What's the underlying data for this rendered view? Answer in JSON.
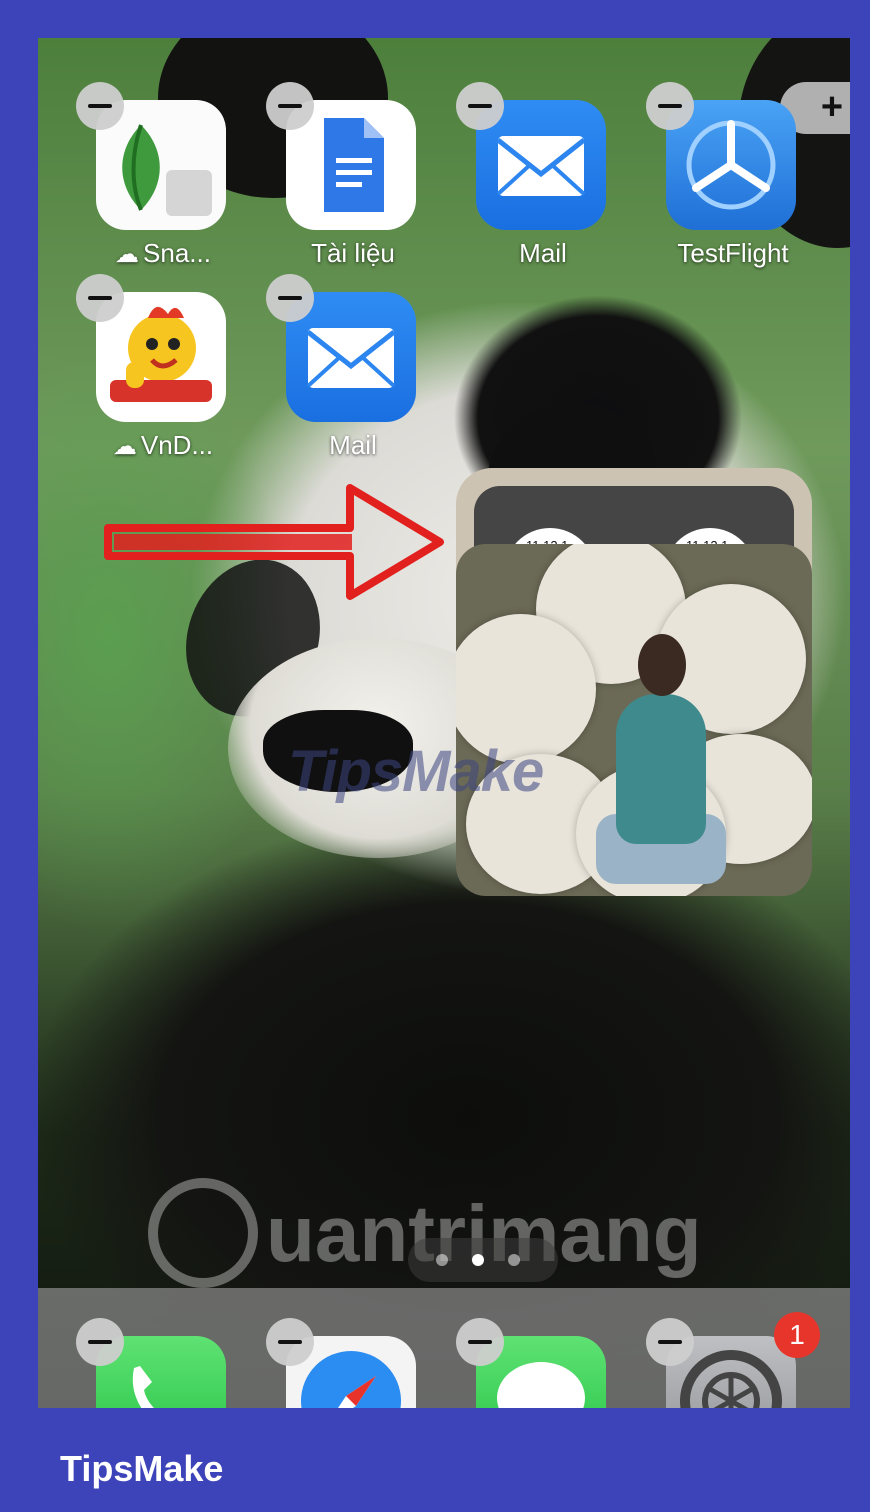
{
  "home_screen": {
    "add_widget_label": "+",
    "apps": [
      {
        "label": "Sna...",
        "icon": "snapseed-icon",
        "cloud": true
      },
      {
        "label": "Tài liệu",
        "icon": "google-docs-icon",
        "cloud": false
      },
      {
        "label": "Mail",
        "icon": "mail-icon",
        "cloud": false
      },
      {
        "label": "TestFlight",
        "icon": "testflight-icon",
        "cloud": false
      },
      {
        "label": "VnD...",
        "icon": "vndoc-icon",
        "cloud": true
      },
      {
        "label": "Mail",
        "icon": "mail-icon",
        "cloud": false
      }
    ],
    "widget": {
      "clocks": [
        "11 12 1",
        "11 12 1"
      ]
    }
  },
  "dock": {
    "apps": [
      {
        "icon": "phone-icon"
      },
      {
        "icon": "safari-icon"
      },
      {
        "icon": "messages-icon"
      },
      {
        "icon": "settings-icon",
        "badge": "1"
      }
    ]
  },
  "watermarks": {
    "tipsmake": "TipsMake",
    "quantrimang": "uantrimang"
  },
  "footer": {
    "brand": "TipsMake"
  },
  "colors": {
    "frame": "#3d44b9",
    "badge": "#e7352c",
    "arrow": "#e2201e"
  }
}
